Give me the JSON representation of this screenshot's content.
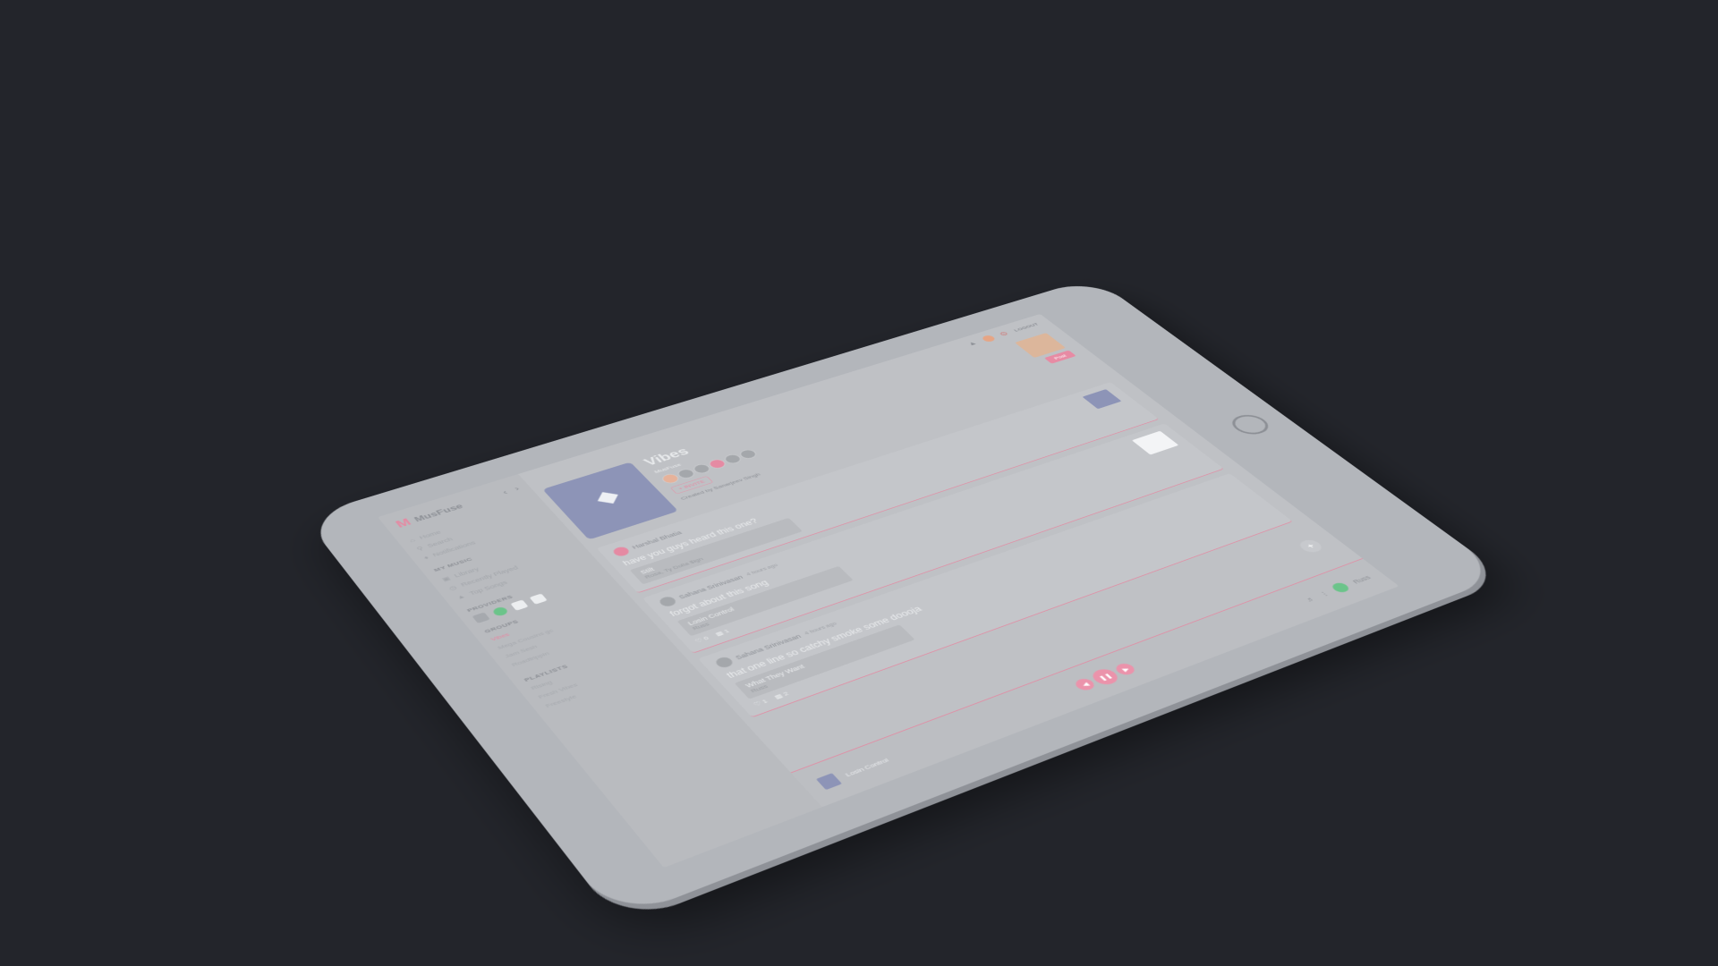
{
  "app": {
    "name": "MusFuse",
    "logo_letter": "M",
    "accent": "#e58aa3"
  },
  "topbar": {
    "logout_label": "LOGOUT"
  },
  "sidebar": {
    "nav_items": [
      {
        "label": "Home",
        "icon": "home-icon"
      },
      {
        "label": "Search",
        "icon": "search-icon"
      },
      {
        "label": "Notifications",
        "icon": "bell-icon"
      }
    ],
    "my_music_title": "MY MUSIC",
    "my_music_items": [
      {
        "label": "Library",
        "icon": "library-icon"
      },
      {
        "label": "Recently Played",
        "icon": "clock-icon"
      },
      {
        "label": "Top Songs",
        "icon": "chart-icon"
      }
    ],
    "providers_title": "PROVIDERS",
    "groups_title": "GROUPS",
    "groups": [
      "Vibes",
      "Mega Cousins gc",
      "Jam Sesh",
      "Roadtrippin"
    ],
    "playlists_title": "PLAYLISTS",
    "playlists": [
      "Rising",
      "Fresh Vibes",
      "Freestyle"
    ]
  },
  "group": {
    "title": "Vibes",
    "subtitle": "MusFuse",
    "invite_label": "+ INVITE",
    "created_by": "Created by Sanarjeev Singh",
    "join_label": "Post"
  },
  "posts": [
    {
      "author": "Harshal Bhatia",
      "time": "",
      "text": "have you guys heard this one?",
      "song_title": "Stilt",
      "song_artist": "Rosa, Ty Dolla $ign",
      "likes": "",
      "comments": ""
    },
    {
      "author": "Sahana Srinivasan",
      "time": "4 hours ago",
      "text": "forgot about this song",
      "song_title": "Losin Control",
      "song_artist": "Russ",
      "likes": "0",
      "comments": "1"
    },
    {
      "author": "Sahana Srinivasan",
      "time": "4 hours ago",
      "text": "that one line so catchy smoke some doooja",
      "song_title": "What They Want",
      "song_artist": "Russ",
      "likes": "1",
      "comments": "2"
    }
  ],
  "player": {
    "now_playing": "Losin Control",
    "provider_label": "Russ"
  }
}
